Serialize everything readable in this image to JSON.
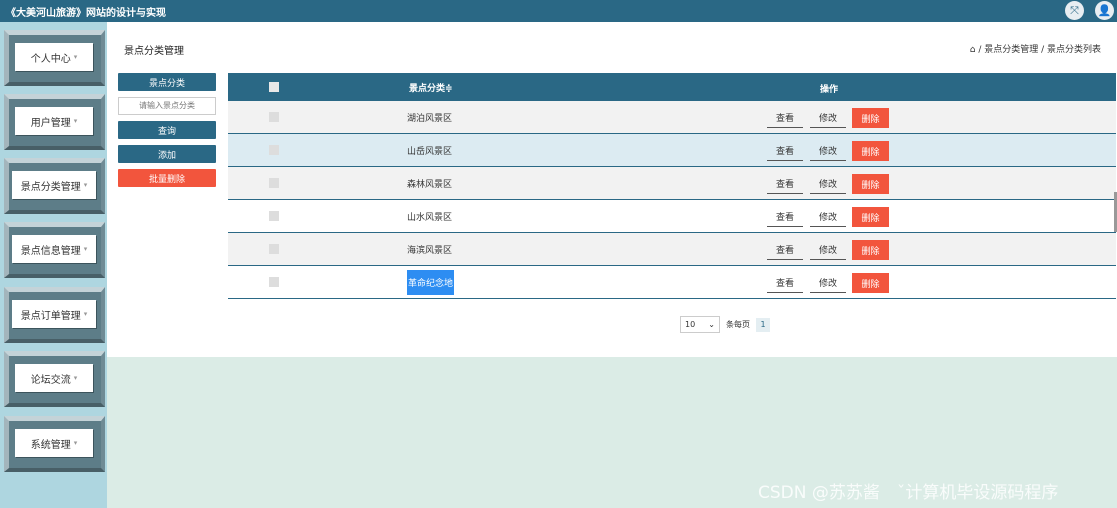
{
  "app": {
    "title": "《大美河山旅游》网站的设计与实现"
  },
  "header_icons": [
    "fullscreen-icon",
    "user-icon"
  ],
  "sidebar": {
    "items": [
      {
        "label": "个人中心"
      },
      {
        "label": "用户管理"
      },
      {
        "label": "景点分类管理"
      },
      {
        "label": "景点信息管理"
      },
      {
        "label": "景点订单管理"
      },
      {
        "label": "论坛交流"
      },
      {
        "label": "系统管理"
      }
    ]
  },
  "page": {
    "title": "景点分类管理",
    "breadcrumb": "⌂ / 景点分类管理 / 景点分类列表"
  },
  "filter": {
    "field_label": "景点分类",
    "placeholder": "请输入景点分类",
    "search_label": "查询",
    "add_label": "添加",
    "batch_delete_label": "批量删除"
  },
  "table": {
    "headers": {
      "name": "景点分类≑",
      "ops": "操作"
    },
    "rows": [
      {
        "name": "湖泊风景区"
      },
      {
        "name": "山岳风景区"
      },
      {
        "name": "森林风景区"
      },
      {
        "name": "山水风景区"
      },
      {
        "name": "海滨风景区"
      },
      {
        "name": "革命纪念地"
      }
    ],
    "actions": {
      "view": "查看",
      "edit": "修改",
      "delete": "删除"
    }
  },
  "pager": {
    "page_size": "10",
    "per_page_label": "条每页",
    "current_page": "1"
  },
  "watermark": "CSDN @苏苏酱　ˇ计算机毕设源码程序",
  "colors": {
    "primary": "#2a6885",
    "danger": "#f2553d",
    "selection": "#2d8df2",
    "sidebar": "#aed6e0"
  }
}
